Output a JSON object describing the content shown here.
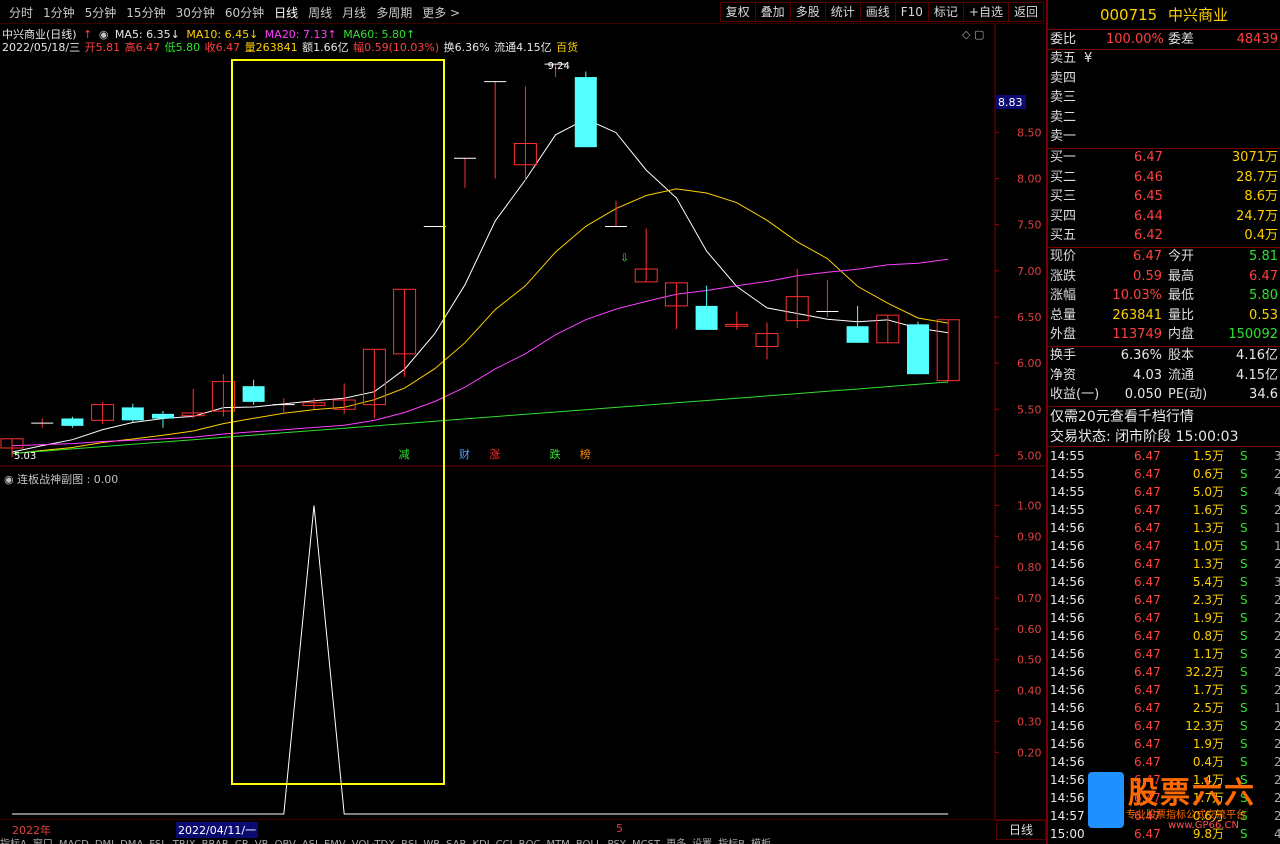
{
  "toolbar": {
    "periods": [
      "分时",
      "1分钟",
      "5分钟",
      "15分钟",
      "30分钟",
      "60分钟",
      "日线",
      "周线",
      "月线",
      "多周期",
      "更多 >"
    ],
    "active_period": "日线",
    "tools": [
      "复权",
      "叠加",
      "多股",
      "统计",
      "画线",
      "F10",
      "标记",
      "+自选",
      "返回"
    ]
  },
  "chart_header": {
    "title": "中兴商业(日线)",
    "ma5": "MA5: 6.35↓",
    "ma10": "MA10: 6.45↓",
    "ma20": "MA20: 7.13↑",
    "ma60": "MA60: 5.80↑",
    "colors": {
      "ma5": "#ffffff",
      "ma10": "#ffd000",
      "ma20": "#ff40ff",
      "ma60": "#30e030"
    }
  },
  "ohlc": {
    "date": "2022/05/18/三",
    "open": "开5.81",
    "high": "高6.47",
    "low": "低5.80",
    "close": "收6.47",
    "volume": "量263841",
    "amount": "额1.66亿",
    "change": "幅0.59(10.03%)",
    "turnover": "换6.36%",
    "float": "流通4.15亿",
    "category": "百货"
  },
  "price_axis": {
    "labels": [
      "8.83",
      "8.50",
      "8.00",
      "7.50",
      "7.00",
      "6.50",
      "6.00",
      "5.50",
      "5.00"
    ],
    "current": "8.83"
  },
  "annotations": {
    "max_label": "9.24",
    "min_label": "5.03",
    "event_tags": [
      "减",
      "财",
      "涨",
      "跌",
      "榜"
    ]
  },
  "sub_chart": {
    "title": "连板战神副图 : 0.00",
    "axis_labels": [
      "1.00",
      "0.90",
      "0.80",
      "0.70",
      "0.60",
      "0.50",
      "0.40",
      "0.30",
      "0.20"
    ]
  },
  "chart_data": {
    "type": "candlestick",
    "candles": [
      {
        "o": 5.08,
        "h": 5.18,
        "l": 4.98,
        "c": 5.18
      },
      {
        "o": 5.35,
        "h": 5.4,
        "l": 5.3,
        "c": 5.35
      },
      {
        "o": 5.4,
        "h": 5.42,
        "l": 5.3,
        "c": 5.32
      },
      {
        "o": 5.38,
        "h": 5.58,
        "l": 5.34,
        "c": 5.55
      },
      {
        "o": 5.52,
        "h": 5.56,
        "l": 5.36,
        "c": 5.38
      },
      {
        "o": 5.45,
        "h": 5.48,
        "l": 5.3,
        "c": 5.4
      },
      {
        "o": 5.43,
        "h": 5.72,
        "l": 5.4,
        "c": 5.46
      },
      {
        "o": 5.48,
        "h": 5.88,
        "l": 5.42,
        "c": 5.8
      },
      {
        "o": 5.75,
        "h": 5.82,
        "l": 5.55,
        "c": 5.58
      },
      {
        "o": 5.55,
        "h": 5.62,
        "l": 5.45,
        "c": 5.55
      },
      {
        "o": 5.54,
        "h": 5.62,
        "l": 5.5,
        "c": 5.57
      },
      {
        "o": 5.5,
        "h": 5.78,
        "l": 5.45,
        "c": 5.6
      },
      {
        "o": 5.55,
        "h": 6.15,
        "l": 5.4,
        "c": 6.15
      },
      {
        "o": 6.1,
        "h": 6.8,
        "l": 5.85,
        "c": 6.8
      },
      {
        "o": 7.48,
        "h": 7.48,
        "l": 7.48,
        "c": 7.48
      },
      {
        "o": 8.22,
        "h": 8.22,
        "l": 7.9,
        "c": 8.22
      },
      {
        "o": 9.05,
        "h": 9.05,
        "l": 8.0,
        "c": 9.05
      },
      {
        "o": 8.15,
        "h": 9.0,
        "l": 7.98,
        "c": 8.38
      },
      {
        "o": 9.24,
        "h": 9.24,
        "l": 9.1,
        "c": 9.24
      },
      {
        "o": 9.1,
        "h": 9.16,
        "l": 8.34,
        "c": 8.34
      },
      {
        "o": 7.48,
        "h": 7.76,
        "l": 7.48,
        "c": 7.48
      },
      {
        "o": 6.88,
        "h": 7.46,
        "l": 6.88,
        "c": 7.02
      },
      {
        "o": 6.62,
        "h": 6.87,
        "l": 6.37,
        "c": 6.87
      },
      {
        "o": 6.62,
        "h": 6.84,
        "l": 6.36,
        "c": 6.36
      },
      {
        "o": 6.4,
        "h": 6.56,
        "l": 6.36,
        "c": 6.42
      },
      {
        "o": 6.18,
        "h": 6.44,
        "l": 6.04,
        "c": 6.32
      },
      {
        "o": 6.46,
        "h": 7.02,
        "l": 6.38,
        "c": 6.72
      },
      {
        "o": 6.56,
        "h": 6.9,
        "l": 6.5,
        "c": 6.56
      },
      {
        "o": 6.4,
        "h": 6.62,
        "l": 6.22,
        "c": 6.22
      },
      {
        "o": 6.22,
        "h": 6.52,
        "l": 6.22,
        "c": 6.52
      },
      {
        "o": 6.42,
        "h": 6.45,
        "l": 5.88,
        "c": 5.88
      },
      {
        "o": 5.81,
        "h": 6.47,
        "l": 5.8,
        "c": 6.47
      }
    ],
    "ylim": [
      4.95,
      9.35
    ],
    "sub_series": {
      "ylim": [
        0.0,
        1.05
      ]
    }
  },
  "bottom": {
    "year_label": "2022年",
    "selected_date": "2022/04/11/一",
    "mid_label": "5",
    "dayline": "日线",
    "tabs": [
      "指标A",
      "窗口",
      "MACD",
      "DMI",
      "DMA",
      "FSL",
      "TRIX",
      "BRAR",
      "CR",
      "VR",
      "OBV",
      "ASI",
      "EMV",
      "VOL-TDX",
      "RSI",
      "WR",
      "SAR",
      "KDJ",
      "CCI",
      "ROC",
      "MTM",
      "BOLL",
      "PSY",
      "MCST",
      "更多",
      "设置",
      "指标B",
      "模板"
    ]
  },
  "quote": {
    "code": "000715",
    "name": "中兴商业",
    "weibi_label": "委比",
    "weibi": "100.00%",
    "weicha_label": "委差",
    "weicha": "48439",
    "sell": [
      {
        "label": "卖五",
        "price": "¥",
        "vol": ""
      },
      {
        "label": "卖四",
        "price": "",
        "vol": ""
      },
      {
        "label": "卖三",
        "price": "",
        "vol": ""
      },
      {
        "label": "卖二",
        "price": "",
        "vol": ""
      },
      {
        "label": "卖一",
        "price": "",
        "vol": ""
      }
    ],
    "buy": [
      {
        "label": "买一",
        "price": "6.47",
        "vol": "3071万"
      },
      {
        "label": "买二",
        "price": "6.46",
        "vol": "28.7万"
      },
      {
        "label": "买三",
        "price": "6.45",
        "vol": "8.6万"
      },
      {
        "label": "买四",
        "price": "6.44",
        "vol": "24.7万"
      },
      {
        "label": "买五",
        "price": "6.42",
        "vol": "0.4万"
      }
    ],
    "stats": [
      {
        "k1": "现价",
        "v1": "6.47",
        "k2": "今开",
        "v2": "5.81"
      },
      {
        "k1": "涨跌",
        "v1": "0.59",
        "k2": "最高",
        "v2": "6.47"
      },
      {
        "k1": "涨幅",
        "v1": "10.03%",
        "k2": "最低",
        "v2": "5.80"
      },
      {
        "k1": "总量",
        "v1": "263841",
        "k2": "量比",
        "v2": "0.53"
      },
      {
        "k1": "外盘",
        "v1": "113749",
        "k2": "内盘",
        "v2": "150092"
      }
    ],
    "fin": [
      {
        "k1": "换手",
        "v1": "6.36%",
        "k2": "股本",
        "v2": "4.16亿"
      },
      {
        "k1": "净资",
        "v1": "4.03",
        "k2": "流通",
        "v2": "4.15亿"
      },
      {
        "k1": "收益(一)",
        "v1": "0.050",
        "k2": "PE(动)",
        "v2": "34.6"
      }
    ],
    "promo": "仅需20元查看千档行情",
    "status": "交易状态: 闭市阶段 15:00:03",
    "ticks": [
      {
        "t": "14:55",
        "p": "6.47",
        "v": "1.5万",
        "f": "S",
        "n": "3"
      },
      {
        "t": "14:55",
        "p": "6.47",
        "v": "0.6万",
        "f": "S",
        "n": "2"
      },
      {
        "t": "14:55",
        "p": "6.47",
        "v": "5.0万",
        "f": "S",
        "n": "4"
      },
      {
        "t": "14:55",
        "p": "6.47",
        "v": "1.6万",
        "f": "S",
        "n": "2"
      },
      {
        "t": "14:56",
        "p": "6.47",
        "v": "1.3万",
        "f": "S",
        "n": "1"
      },
      {
        "t": "14:56",
        "p": "6.47",
        "v": "1.0万",
        "f": "S",
        "n": "1"
      },
      {
        "t": "14:56",
        "p": "6.47",
        "v": "1.3万",
        "f": "S",
        "n": "2"
      },
      {
        "t": "14:56",
        "p": "6.47",
        "v": "5.4万",
        "f": "S",
        "n": "3"
      },
      {
        "t": "14:56",
        "p": "6.47",
        "v": "2.3万",
        "f": "S",
        "n": "2"
      },
      {
        "t": "14:56",
        "p": "6.47",
        "v": "1.9万",
        "f": "S",
        "n": "2"
      },
      {
        "t": "14:56",
        "p": "6.47",
        "v": "0.8万",
        "f": "S",
        "n": "2"
      },
      {
        "t": "14:56",
        "p": "6.47",
        "v": "1.1万",
        "f": "S",
        "n": "2"
      },
      {
        "t": "14:56",
        "p": "6.47",
        "v": "32.2万",
        "f": "S",
        "n": "2"
      },
      {
        "t": "14:56",
        "p": "6.47",
        "v": "1.7万",
        "f": "S",
        "n": "2"
      },
      {
        "t": "14:56",
        "p": "6.47",
        "v": "2.5万",
        "f": "S",
        "n": "1"
      },
      {
        "t": "14:56",
        "p": "6.47",
        "v": "12.3万",
        "f": "S",
        "n": "2"
      },
      {
        "t": "14:56",
        "p": "6.47",
        "v": "1.9万",
        "f": "S",
        "n": "2"
      },
      {
        "t": "14:56",
        "p": "6.47",
        "v": "0.4万",
        "f": "S",
        "n": "2"
      },
      {
        "t": "14:56",
        "p": "6.47",
        "v": "1.4万",
        "f": "S",
        "n": "2"
      },
      {
        "t": "14:56",
        "p": "6.47",
        "v": "1.7万",
        "f": "S",
        "n": "2"
      },
      {
        "t": "14:57",
        "p": "6.47",
        "v": "0.6万",
        "f": "S",
        "n": "2"
      },
      {
        "t": "15:00",
        "p": "6.47",
        "v": "9.8万",
        "f": "S",
        "n": "46"
      }
    ]
  },
  "watermark": {
    "brand": "股票六六",
    "slogan": "专业股票指标公式交流平台",
    "site": "www.GP66.CN"
  }
}
